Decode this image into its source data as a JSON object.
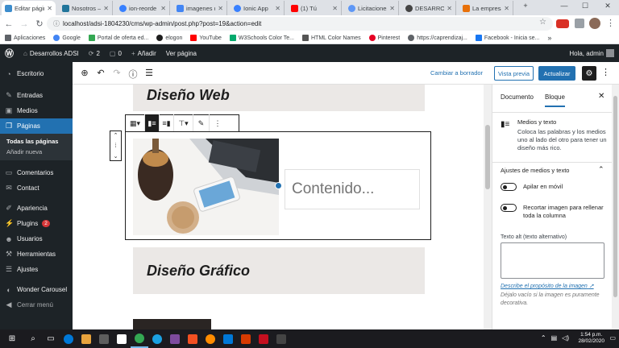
{
  "browser": {
    "tabs": [
      {
        "label": "Editar página",
        "color": "#3c8ccc",
        "active": true
      },
      {
        "label": "Nosotros –",
        "color": "#21759b"
      },
      {
        "label": "ion-reorde",
        "color": "#3880ff"
      },
      {
        "label": "imagenes d",
        "color": "#4285f4"
      },
      {
        "label": "Ionic App",
        "color": "#3880ff"
      },
      {
        "label": "(1) Tú",
        "color": "#ff0000"
      },
      {
        "label": "Licitaciones",
        "color": "#5e97f6"
      },
      {
        "label": "DESARROLL",
        "color": "#444444"
      },
      {
        "label": "La empresa",
        "color": "#e8710a"
      }
    ],
    "url": "localhost/adsi-1804230/cms/wp-admin/post.php?post=19&action=edit",
    "bookmarks": [
      {
        "label": "Aplicaciones",
        "color": "#5f6368"
      },
      {
        "label": "Google",
        "color": "#4285f4"
      },
      {
        "label": "Portal de oferta ed...",
        "color": "#34a853"
      },
      {
        "label": "elogon",
        "color": "#1e1e1e"
      },
      {
        "label": "YouTube",
        "color": "#ff0000"
      },
      {
        "label": "W3Schools Color Te...",
        "color": "#04aa6d"
      },
      {
        "label": "HTML Color Names",
        "color": "#555555"
      },
      {
        "label": "Pinterest",
        "color": "#e60023"
      },
      {
        "label": "https://caprendizaj...",
        "color": "#5f6368"
      },
      {
        "label": "Facebook - Inicia se...",
        "color": "#1877f2"
      }
    ],
    "more_glyph": "»"
  },
  "adminbar": {
    "site_name": "Desarrollos ADSI",
    "updates": "2",
    "comments": "0",
    "add_new": "Añadir",
    "view_page": "Ver página",
    "greeting": "Hola, admin"
  },
  "menu": {
    "dashboard": "Escritorio",
    "posts": "Entradas",
    "media": "Medios",
    "pages": "Páginas",
    "pages_sub": [
      "Todas las páginas",
      "Añadir nueva"
    ],
    "comments": "Comentarios",
    "contact": "Contact",
    "appearance": "Apariencia",
    "plugins": "Plugins",
    "plugins_badge": "2",
    "users": "Usuarios",
    "tools": "Herramientas",
    "settings": "Ajustes",
    "wonder": "Wonder Carousel",
    "collapse": "Cerrar menú"
  },
  "editor": {
    "save_draft": "Cambiar a borrador",
    "preview": "Vista previa",
    "update": "Actualizar",
    "heading1": "Diseño Web",
    "content_placeholder": "Contenido...",
    "heading2": "Diseño Gráfico"
  },
  "sidebar": {
    "tab_document": "Documento",
    "tab_block": "Bloque",
    "block_title": "Medios y texto",
    "block_desc": "Coloca las palabras y los medios uno al lado del otro para tener un diseño más rico.",
    "panel_title": "Ajustes de medios y texto",
    "toggle1": "Apilar en móvil",
    "toggle2": "Recortar imagen para rellenar toda la columna",
    "alt_label": "Texto alt (texto alternativo)",
    "alt_link": "Describe el propósito de la imagen",
    "alt_help": "Déjalo vacío si la imagen es puramente decorativa."
  },
  "taskbar": {
    "time": "1:54 p.m.",
    "date": "28/02/2020",
    "app_colors": [
      "#0078d7",
      "#e8a33d",
      "#5e5e5e",
      "#ffffff",
      "#34a853",
      "#1ba1e2",
      "#7d4b9e",
      "#f25022",
      "#ff8c00",
      "#0078d7",
      "#d83b01",
      "#c50f1f",
      "#444444"
    ]
  }
}
